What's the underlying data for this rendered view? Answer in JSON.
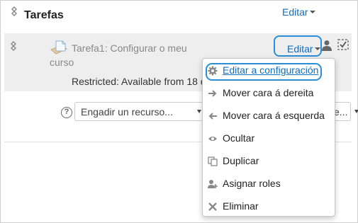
{
  "section": {
    "title": "Tarefas",
    "edit_label": "Editar"
  },
  "activity": {
    "name_line1": "Tarefa1: Configurar o meu",
    "name_line2": "curso",
    "edit_label": "Editar",
    "restriction": "Restricted: Available from 18 d"
  },
  "add_resource": {
    "placeholder": "Engadir un recurso...",
    "help": "?",
    "activity_stub": "e..."
  },
  "menu": {
    "items": [
      {
        "label": "Editar a configuración",
        "icon": "gear-icon"
      },
      {
        "label": "Mover cara á dereita",
        "icon": "arrow-right-icon"
      },
      {
        "label": "Mover cara á esquerda",
        "icon": "arrow-left-icon"
      },
      {
        "label": "Ocultar",
        "icon": "eye-icon"
      },
      {
        "label": "Duplicar",
        "icon": "duplicate-icon"
      },
      {
        "label": "Asignar roles",
        "icon": "assign-roles-icon"
      },
      {
        "label": "Eliminar",
        "icon": "delete-icon"
      }
    ]
  },
  "colors": {
    "link": "#0f6cbf",
    "focus": "#2a8fd8",
    "row_bg": "#eeeeee"
  }
}
